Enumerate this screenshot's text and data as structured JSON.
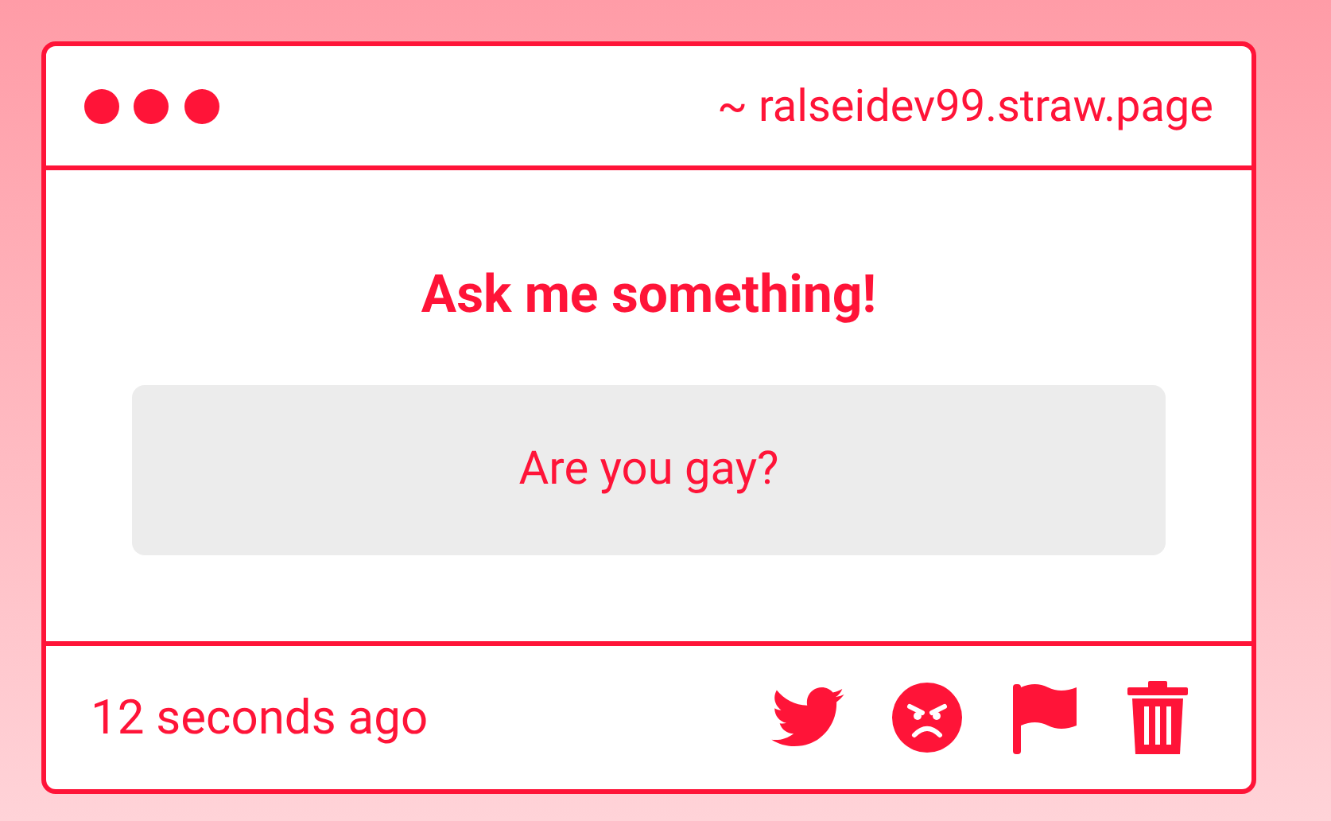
{
  "header": {
    "address": "~ ralseidev99.straw.page"
  },
  "prompt": {
    "title": "Ask me something!",
    "question": "Are you gay?"
  },
  "footer": {
    "time": "12 seconds ago"
  }
}
